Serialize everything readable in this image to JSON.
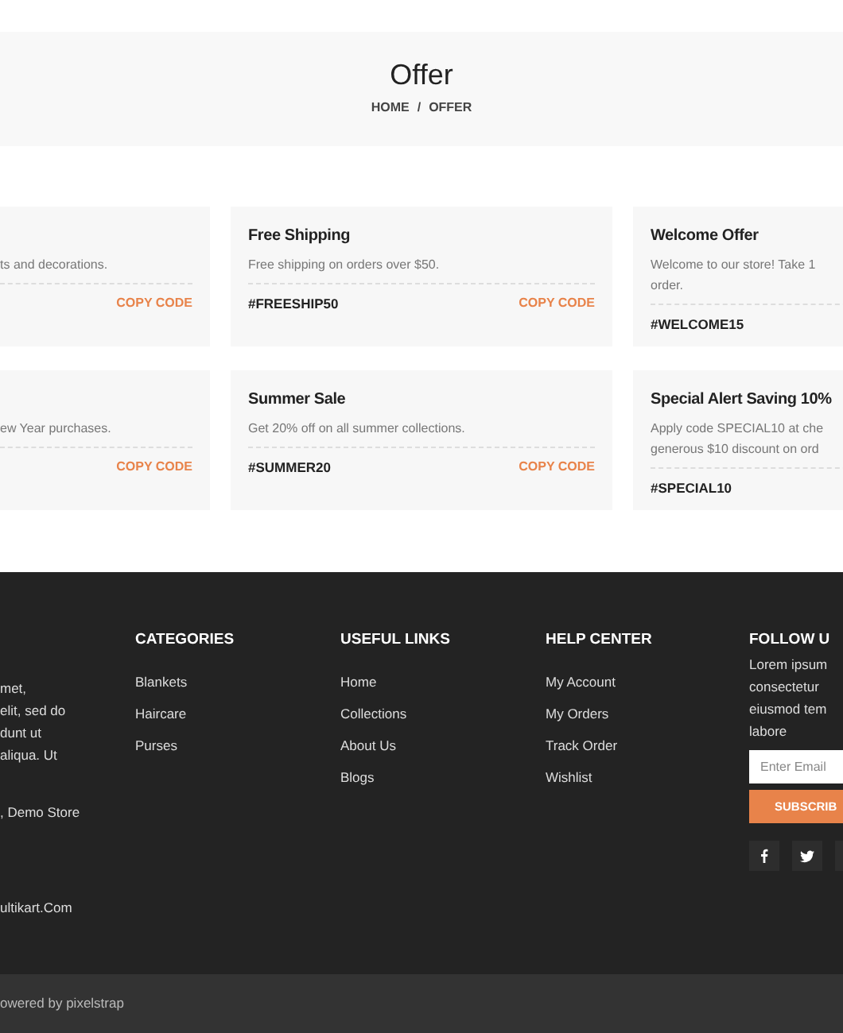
{
  "header": {
    "title": "Offer",
    "breadcrumb": [
      "HOME",
      "OFFER"
    ],
    "separator": "/"
  },
  "offers": [
    {
      "description": [
        "ts and decorations."
      ],
      "copy_label": "COPY CODE"
    },
    {
      "title": "Free Shipping",
      "description": [
        "Free shipping on orders over $50."
      ],
      "code": "#FREESHIP50",
      "copy_label": "COPY CODE"
    },
    {
      "title": "Welcome Offer",
      "description": [
        "Welcome to our store! Take 1",
        "order."
      ],
      "code": "#WELCOME15"
    },
    {
      "description": [
        "ew Year purchases."
      ],
      "copy_label": "COPY CODE"
    },
    {
      "title": "Summer Sale",
      "description": [
        "Get 20% off on all summer collections."
      ],
      "code": "#SUMMER20",
      "copy_label": "COPY CODE"
    },
    {
      "title": "Special Alert Saving 10%",
      "description": [
        "Apply code SPECIAL10 at che",
        "generous $10 discount on ord"
      ],
      "code": "#SPECIAL10"
    }
  ],
  "footer": {
    "about": {
      "lines": [
        "met,",
        "elit, sed do",
        "dunt ut",
        "aliqua. Ut"
      ],
      "address": ", Demo Store",
      "email": "ultikart.Com"
    },
    "columns": [
      {
        "heading": "CATEGORIES",
        "links": [
          "Blankets",
          "Haircare",
          "Purses"
        ]
      },
      {
        "heading": "USEFUL LINKS",
        "links": [
          "Home",
          "Collections",
          "About Us",
          "Blogs"
        ]
      },
      {
        "heading": "HELP CENTER",
        "links": [
          "My Account",
          "My Orders",
          "Track Order",
          "Wishlist"
        ]
      }
    ],
    "follow": {
      "heading": "FOLLOW U",
      "text": [
        "Lorem ipsum",
        "consectetur",
        "eiusmod tem",
        "labore"
      ],
      "email_placeholder": "Enter Email",
      "subscribe_label": "SUBSCRIB",
      "social": [
        {
          "kind": "facebook"
        },
        {
          "kind": "twitter"
        },
        {
          "kind": "partial"
        }
      ]
    }
  },
  "bottom_bar": {
    "copyright": "owered by pixelstrap"
  }
}
